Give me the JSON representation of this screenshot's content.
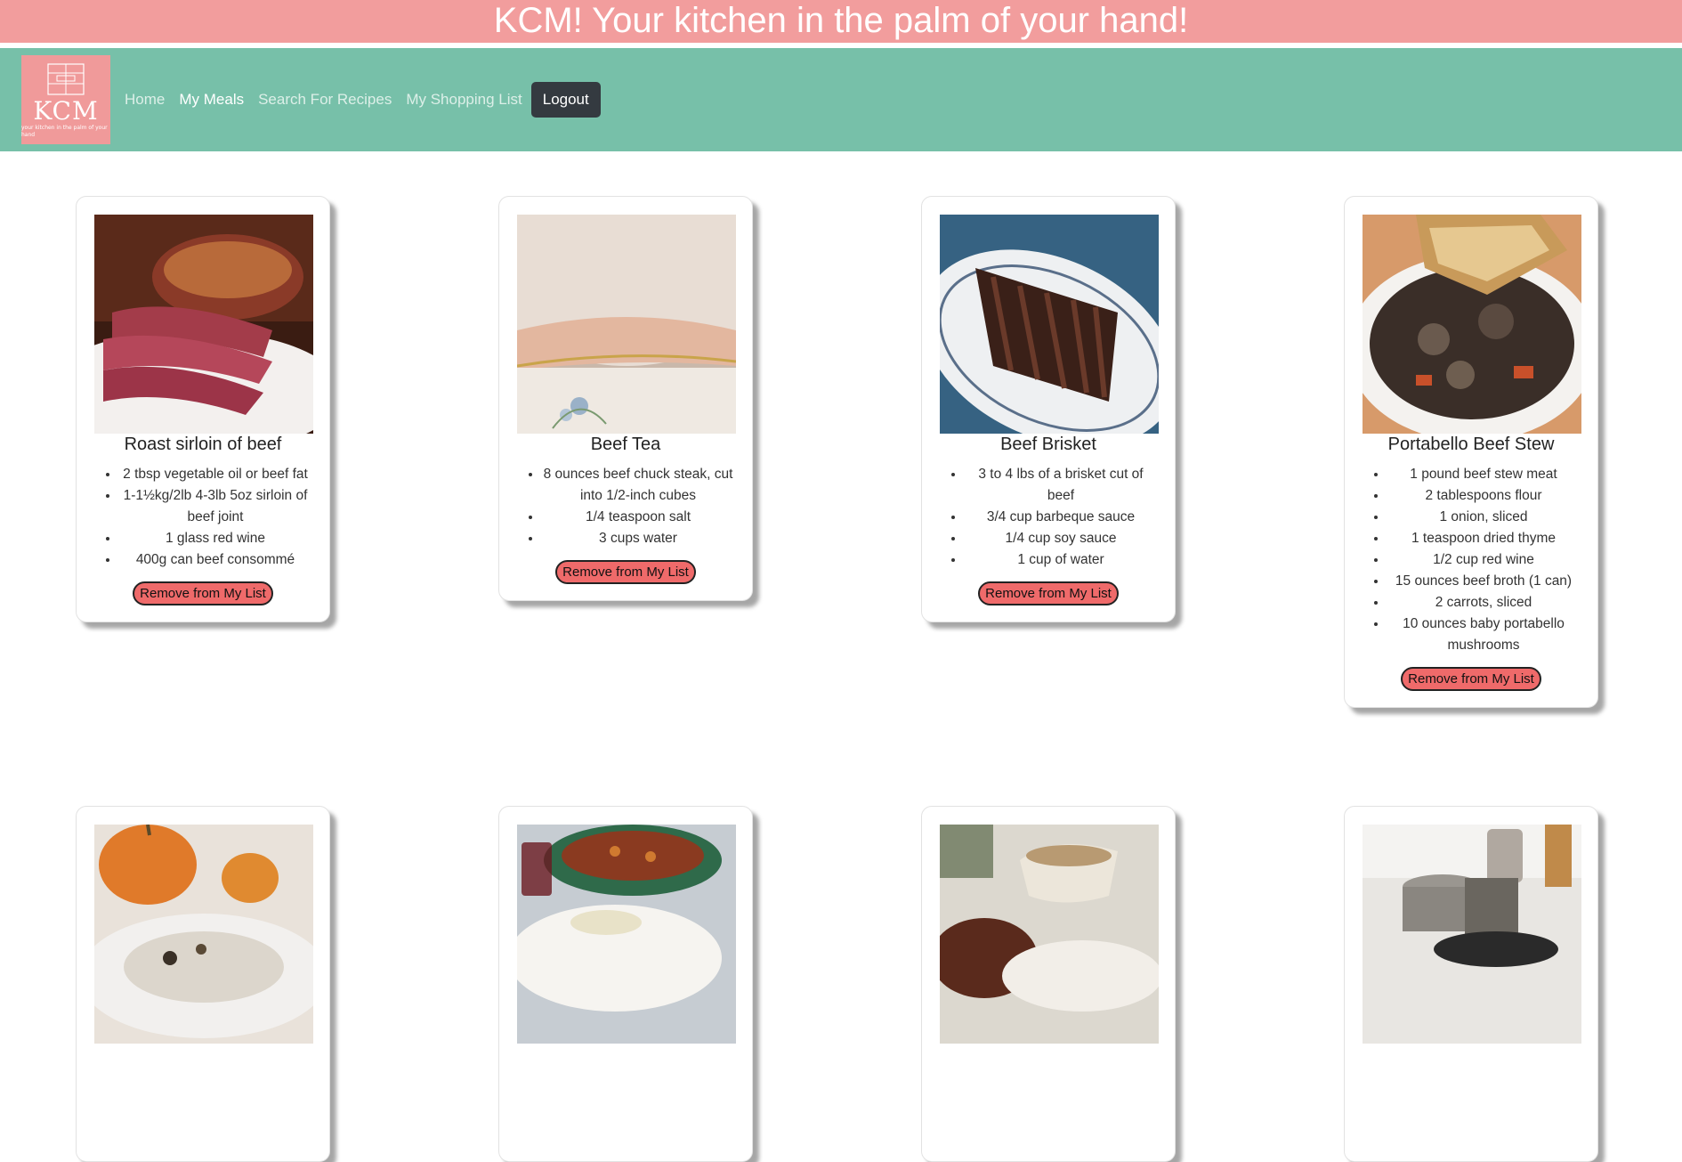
{
  "banner": {
    "text": "KCM! Your kitchen in the palm of your hand!"
  },
  "logo": {
    "text": "KCM",
    "subtext": "your kitchen in the palm of your hand"
  },
  "nav": {
    "items": [
      {
        "label": "Home"
      },
      {
        "label": "My Meals"
      },
      {
        "label": "Search For Recipes"
      },
      {
        "label": "My Shopping List"
      }
    ],
    "logout_label": "Logout"
  },
  "cards": [
    {
      "title": "Roast sirloin of beef",
      "ingredients": [
        "2 tbsp vegetable oil or beef fat",
        "1-1½kg/2lb 4-3lb 5oz sirloin of beef joint",
        "1 glass red wine",
        "400g can beef consommé"
      ],
      "button": "Remove from My List"
    },
    {
      "title": "Beef Tea",
      "ingredients": [
        "8 ounces beef chuck steak, cut into 1/2-inch cubes",
        "1/4 teaspoon salt",
        "3 cups water"
      ],
      "button": "Remove from My List"
    },
    {
      "title": "Beef Brisket",
      "ingredients": [
        "3 to 4 lbs of a brisket cut of beef",
        "3/4 cup barbeque sauce",
        "1/4 cup soy sauce",
        "1 cup of water"
      ],
      "button": "Remove from My List"
    },
    {
      "title": "Portabello Beef Stew",
      "ingredients": [
        "1 pound beef stew meat",
        "2 tablespoons flour",
        "1 onion, sliced",
        "1 teaspoon dried thyme",
        "1/2 cup red wine",
        "15 ounces beef broth (1 can)",
        "2 carrots, sliced",
        "10 ounces baby portabello mushrooms"
      ],
      "button": "Remove from My List"
    },
    {
      "title": "",
      "ingredients": [],
      "button": ""
    },
    {
      "title": "",
      "ingredients": [],
      "button": ""
    },
    {
      "title": "",
      "ingredients": [],
      "button": ""
    },
    {
      "title": "",
      "ingredients": [],
      "button": ""
    }
  ],
  "colors": {
    "banner": "#f29d9d",
    "navbar": "#77c0a9",
    "logo_bg": "#f09a9a",
    "logout_bg": "#343a40",
    "remove_button": "#ef6a6a"
  }
}
